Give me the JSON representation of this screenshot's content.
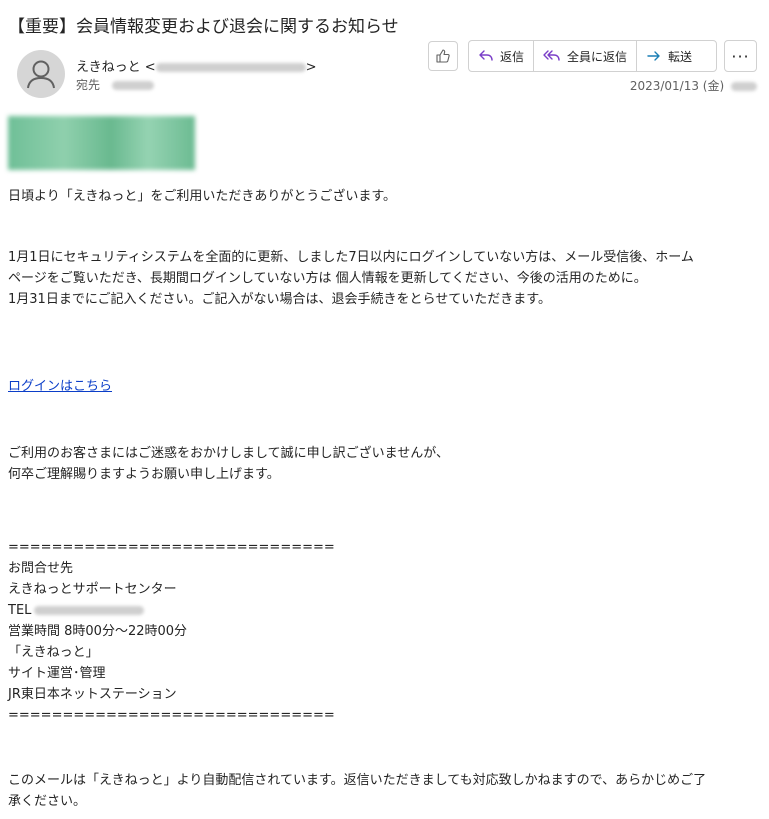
{
  "header": {
    "subject": "【重要】会員情報変更および退会に関するお知らせ",
    "sender_name": "えきねっと",
    "to_label": "宛先",
    "date": "2023/01/13 (金)"
  },
  "toolbar": {
    "reply_label": "返信",
    "reply_all_label": "全員に返信",
    "forward_label": "転送",
    "more_label": "···"
  },
  "body": {
    "greeting": "日頃より「えきねっと」をご利用いただきありがとうございます。",
    "para1_line1": "1月1日にセキュリティシステムを全面的に更新、しました7日以内にログインしていない方は、メール受信後、ホーム",
    "para1_line2": "ページをご覧いただき、長期間ログインしていない方は 個人情報を更新してください、今後の活用のために。",
    "para1_line3": "1月31日までにご記入ください。ご記入がない場合は、退会手続きをとらせていただきます。",
    "login_link": "ログインはこちら",
    "apology_line1": "ご利用のお客さまにはご迷惑をおかけしまして誠に申し訳ございませんが、",
    "apology_line2": "何卒ご理解賜りますようお願い申し上げます。",
    "separator": "==============================",
    "contact_title": "お問合せ先",
    "support_center": "えきねっとサポートセンター",
    "tel_label": "TEL",
    "hours": "営業時間 8時00分～22時00分",
    "service_name": "「えきねっと」",
    "site_admin": "サイト運営･管理",
    "company": "JR東日本ネットステーション",
    "footer_line1": "このメールは「えきねっと」より自動配信されています。返信いただきましても対応致しかねますので、あらかじめご了",
    "footer_line2": "承ください。"
  },
  "colors": {
    "link": "#0b3ec8",
    "accent": "#7a3ec8",
    "forward_icon": "#1a7fb5",
    "banner": "#6fbf97"
  }
}
